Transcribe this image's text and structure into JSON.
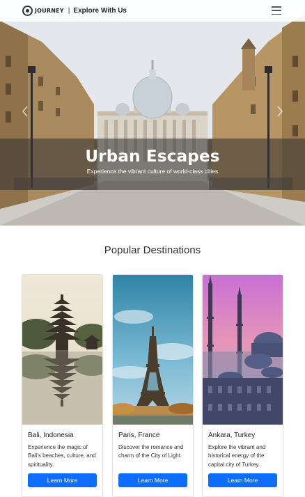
{
  "navbar": {
    "brand_name": "JOURNEY",
    "separator": "|",
    "tagline": "Explore With Us",
    "menu_icon": "hamburger-menu-icon"
  },
  "hero": {
    "title": "Urban Escapes",
    "subtitle": "Experience the vibrant culture of world-class cities",
    "prev_icon": "chevron-left-icon",
    "next_icon": "chevron-right-icon"
  },
  "section": {
    "title": "Popular Destinations"
  },
  "destinations": [
    {
      "name": "Bali, Indonesia",
      "description": "Experience the magic of Bali's beaches, culture, and spirituality.",
      "button_label": "Learn More"
    },
    {
      "name": "Paris, France",
      "description": "Discover the romance and charm of the City of Light.",
      "button_label": "Learn More"
    },
    {
      "name": "Ankara, Turkey",
      "description": "Explore the vibrant and historical energy of the capital city of Turkey.",
      "button_label": "Learn More"
    }
  ],
  "colors": {
    "accent": "#0d6efd",
    "caption_overlay": "#323232"
  }
}
